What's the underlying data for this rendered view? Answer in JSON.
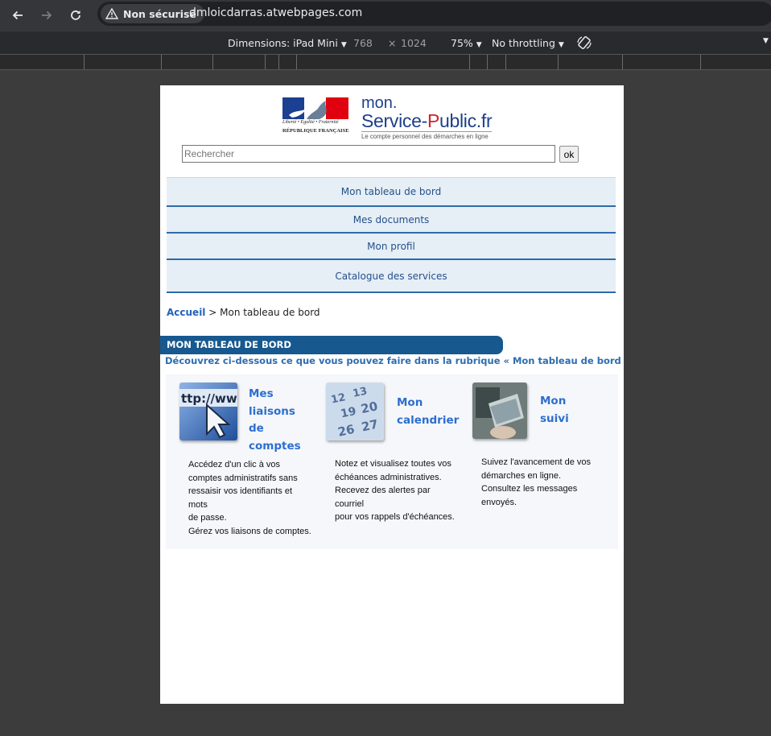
{
  "browser": {
    "security_label": "Non sécurisé",
    "url": "dmloicdarras.atwebpages.com"
  },
  "devtools": {
    "device_label": "Dimensions: iPad Mini",
    "width": "768",
    "times": "×",
    "height": "1024",
    "zoom": "75%",
    "throttling": "No throttling"
  },
  "site": {
    "logo": {
      "mon": "mon.",
      "service": "Service-",
      "p": "P",
      "ublic": "ublic.fr",
      "tagline": "Le compte personnel des démarches en ligne",
      "devise": "Liberté • Égalité • Fraternité",
      "republique": "RÉPUBLIQUE FRANÇAISE"
    },
    "search": {
      "placeholder": "Rechercher",
      "button": "ok"
    },
    "menu": [
      {
        "label": "Mon tableau de bord"
      },
      {
        "label": "Mes documents"
      },
      {
        "label": "Mon profil"
      },
      {
        "label": "Catalogue des services"
      }
    ],
    "breadcrumb": {
      "home": "Accueil",
      "separator": ">",
      "current": "Mon tableau de bord"
    },
    "section_title": "MON TABLEAU DE BORD",
    "intro": "Découvrez ci-dessous ce que vous pouvez faire dans la rubrique « Mon tableau de bord ».",
    "cards": [
      {
        "title_lines": [
          "Mes",
          "liaisons de",
          "comptes"
        ],
        "image": "url-cursor-image",
        "desc_lines": [
          "Accédez d'un clic à vos",
          "comptes administratifs sans",
          "ressaisir vos identifiants et mots",
          "de passe.",
          "Gérez vos liaisons de comptes."
        ]
      },
      {
        "title_lines": [
          "Mon",
          "calendrier"
        ],
        "image": "calendar-image",
        "desc_lines": [
          "Notez et visualisez toutes vos",
          "échéances administratives.",
          "Recevez des alertes par courriel",
          "pour vos rappels d'échéances."
        ]
      },
      {
        "title_lines": [
          "Mon",
          "suivi"
        ],
        "image": "laptop-image",
        "desc_lines": [
          "Suivez l'avancement de vos",
          "démarches en ligne.",
          "Consultez les messages",
          "envoyés."
        ]
      }
    ]
  },
  "colors": {
    "menu_bg": "#e6eef6",
    "menu_border": "#2d6ca8",
    "title_bar": "#17588f",
    "link_blue": "#2d6ed0",
    "brand_red": "#d1222b"
  }
}
